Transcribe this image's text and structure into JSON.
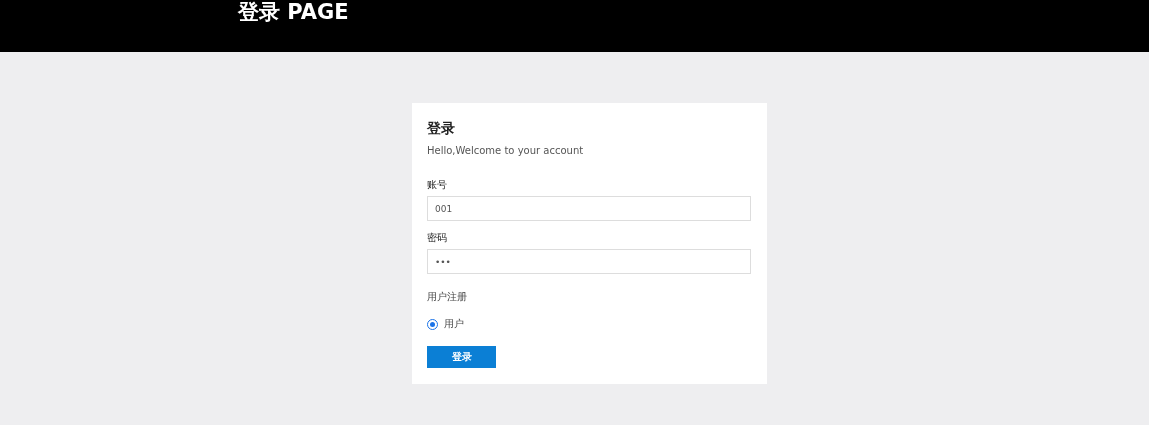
{
  "header": {
    "title": "登录 PAGE"
  },
  "login_card": {
    "title": "登录",
    "subtitle": "Hello,Welcome to your account",
    "fields": [
      {
        "label": "账号",
        "value": "001"
      },
      {
        "label": "密码",
        "value": "•••"
      }
    ],
    "role_group": {
      "label": "用户注册",
      "options": [
        {
          "label": "用户",
          "selected": true
        }
      ]
    },
    "submit_button": "登录"
  }
}
